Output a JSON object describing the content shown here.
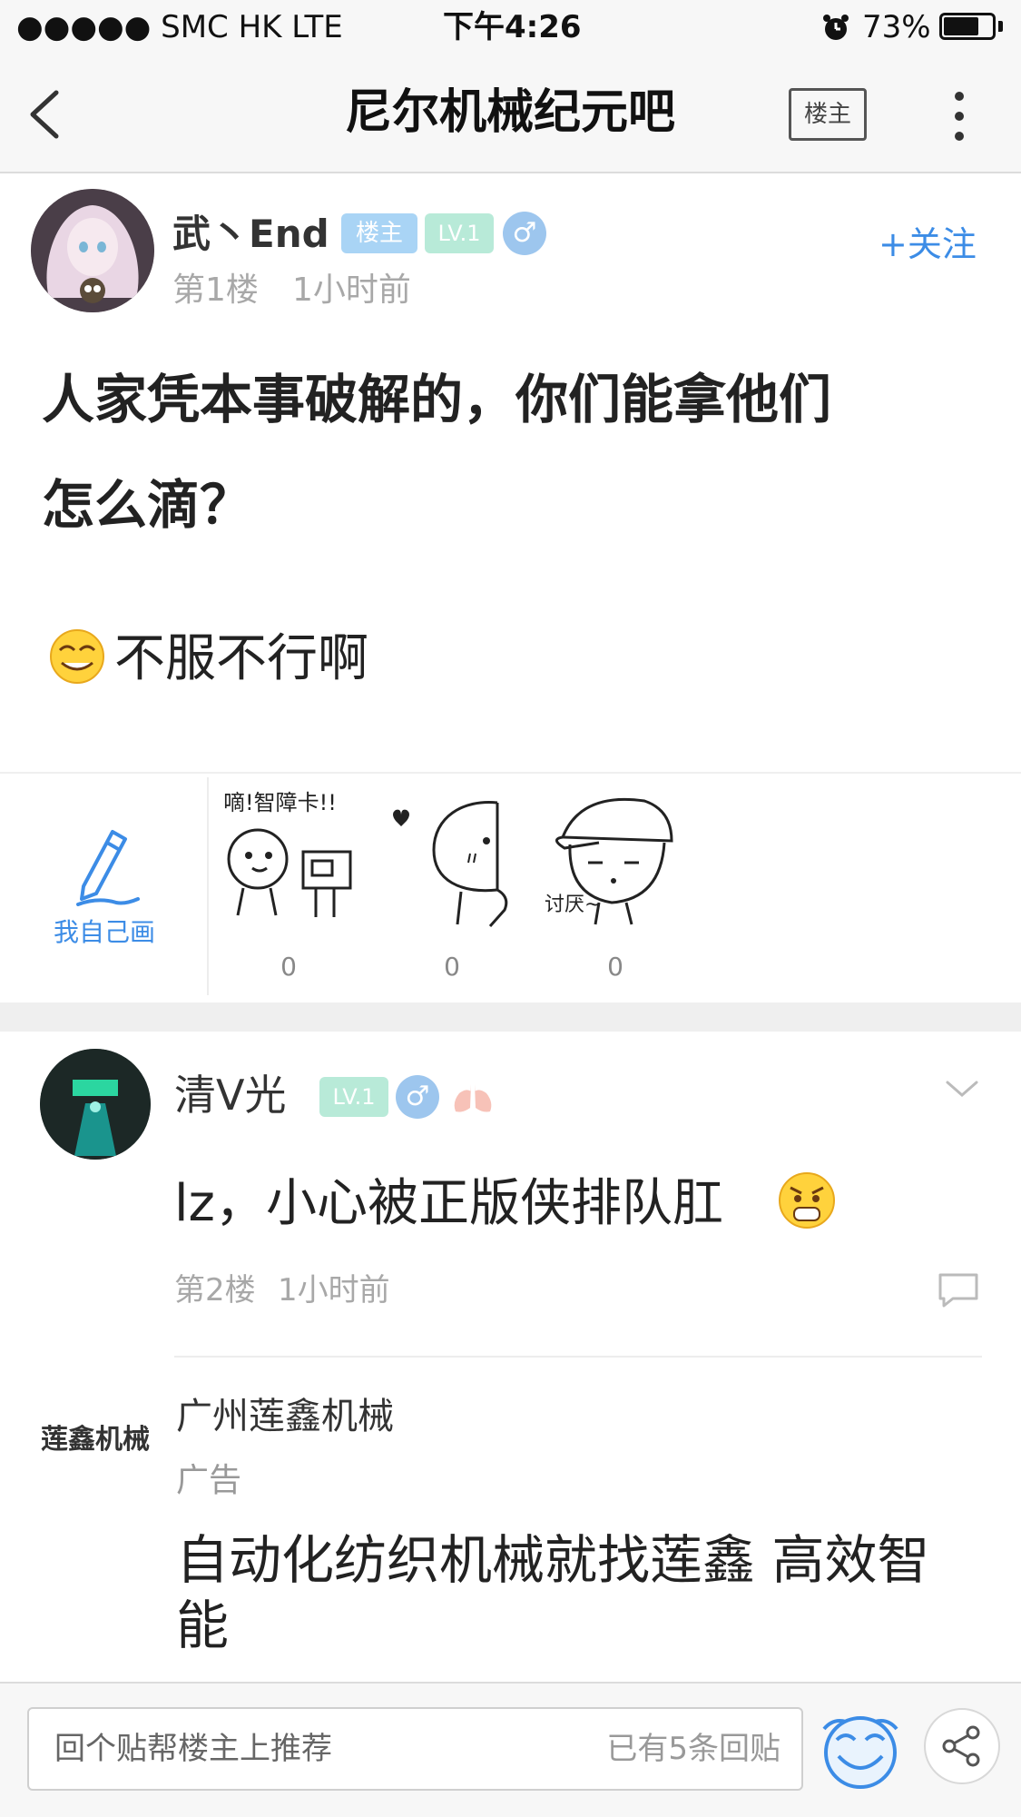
{
  "status_bar": {
    "carrier": "●●●●● SMC HK   LTE",
    "time": "下午4:26",
    "battery": "73%",
    "battery_level": 0.73
  },
  "nav": {
    "title": "尼尔机械纪元吧",
    "owner_button": "楼主"
  },
  "post": {
    "username": "武丶End",
    "badges": {
      "owner": "楼主",
      "level": "LV.1",
      "gender": "♂"
    },
    "floor": "第1楼",
    "time": "1小时前",
    "follow": "+关注",
    "title_line1": "人家凭本事破解的，你们能拿他们",
    "title_line2": "怎么滴？",
    "body": "不服不行啊"
  },
  "stickers": {
    "draw_label": "我自己画",
    "items": [
      {
        "caption": "嘀!智障卡!!",
        "count": "0"
      },
      {
        "caption": "",
        "count": "0"
      },
      {
        "caption": "讨厌~",
        "count": "0"
      }
    ]
  },
  "reply": {
    "username": "清V光",
    "level": "LV.1",
    "gender": "♂",
    "text": "lz，小心被正版侠排队肛",
    "floor": "第2楼",
    "time": "1小时前"
  },
  "ad": {
    "logo": "莲鑫机械",
    "name": "广州莲鑫机械",
    "tag": "广告",
    "text": "自动化纺织机械就找莲鑫 高效智能"
  },
  "bottom_bar": {
    "placeholder": "回个贴帮楼主上推荐",
    "reply_count": "已有5条回贴"
  },
  "colors": {
    "accent": "#3c8ce6",
    "owner_badge": "#a9d4f5",
    "level_badge": "#b8ead8",
    "gender_badge": "#9dc6ee"
  }
}
